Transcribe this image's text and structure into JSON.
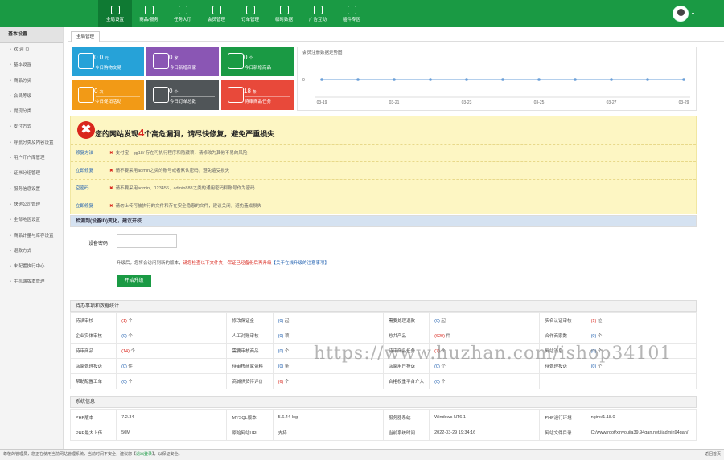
{
  "nav": [
    "全局设置",
    "商品/服务",
    "任务大厅",
    "会员管理",
    "订单管理",
    "临时数据",
    "广告互动",
    "插件专区"
  ],
  "sidebar": {
    "title": "基本设置",
    "items": [
      "欢 迎 页",
      "基本设置",
      "商品分类",
      "会员等级",
      "提现分类",
      "支付方式",
      "导航分类及内容设置",
      "用户开户库管理",
      "证书分组管理",
      "服务信息设置",
      "快递公司管理",
      "全部地区设置",
      "商品计量与库存设置",
      "退款方式",
      "未配置执行中心",
      "手机端版本管理"
    ]
  },
  "tab_label": "全局管理",
  "stats": [
    {
      "value": "0.0",
      "unit": "元",
      "label": "今日购物交易",
      "color": "#26a2d8"
    },
    {
      "value": "0",
      "unit": "家",
      "label": "今日新增商家",
      "color": "#8a56b4"
    },
    {
      "value": "0",
      "unit": "个",
      "label": "今日新增商品",
      "color": "#1a9a44"
    },
    {
      "value": "0",
      "unit": "次",
      "label": "今日促销活动",
      "color": "#f29a16"
    },
    {
      "value": "0",
      "unit": "个",
      "label": "今日订单总数",
      "color": "#505558"
    },
    {
      "value": "18",
      "unit": "条",
      "label": "待审商品任务",
      "color": "#e8493a"
    }
  ],
  "chart_data": {
    "type": "line",
    "title": "会员注册数据走势图",
    "categories": [
      "03-19",
      "03-20",
      "03-21",
      "03-22",
      "03-23",
      "03-24",
      "03-25",
      "03-26",
      "03-27",
      "03-28",
      "03-29"
    ],
    "x_tick_labels": [
      "03-19",
      "03-21",
      "03-23",
      "03-25",
      "03-27",
      "03-29"
    ],
    "series": [
      {
        "values": [
          0,
          0,
          0,
          0,
          0,
          0,
          0,
          0,
          0,
          0,
          0
        ]
      }
    ],
    "yticks": [
      "0"
    ],
    "ylim": [
      0,
      1
    ],
    "color": "#6a9fd8"
  },
  "alert": {
    "prefix": "您的网站发现",
    "count": "4",
    "suffix": "个高危漏洞，请尽快修复，避免严重损失",
    "rows": [
      {
        "key": "修复方法",
        "value": "支付宝：gg18/ 存在可执行程序和隐藏项，请修改为其他不易的风险"
      },
      {
        "key": "立即修复",
        "value": "请不要采用admin之类的账号或者默认密码，避免遭受损失"
      },
      {
        "key": "空密码",
        "value": "请不要采用admin、123456、admin888之类的通用密码和账号作为密码"
      },
      {
        "key": "立即修复",
        "value": "请勿上传可被执行的文件和存在安全隐患的文件，建议关闭，避免造成损失"
      }
    ]
  },
  "reset": {
    "header": "检测到(设备ID)变化，建议开校",
    "label": "设备密码：",
    "note_pre": "升级后，您将会访问到新的版本，",
    "note_red": "请您检查以下文件夹，保证已经备份后再升级",
    "note_link": "【关于在线升级的注意事项】",
    "button": "开始升级"
  },
  "pending": {
    "header": "待办事项和数据统计",
    "rows": [
      [
        [
          "待读审核",
          "(1)",
          "个"
        ],
        [
          "修改保证金",
          "(0)",
          "起"
        ],
        [
          "需要处理退款",
          "(0)",
          "起"
        ],
        [
          "实名认证审核",
          "(1)",
          "位"
        ]
      ],
      [
        [
          "企业实体审核",
          "(0)",
          "个"
        ],
        [
          "人工对账审核",
          "(0)",
          "项"
        ],
        [
          "总共产品",
          "(620)",
          "件"
        ],
        [
          "合作商家数",
          "(0)",
          "个"
        ]
      ],
      [
        [
          "待审商品",
          "(14)",
          "个"
        ],
        [
          "需要审核商品",
          "(0)",
          "个"
        ],
        [
          "待审商品任务",
          "(7)",
          "个"
        ],
        [
          "网站消息",
          "(0)",
          "个"
        ]
      ],
      [
        [
          "店家处理投诉",
          "(0)",
          "件"
        ],
        [
          "待审核商家资料",
          "(0)",
          "条"
        ],
        [
          "店家用户投诉",
          "(0)",
          "个"
        ],
        [
          "待处理投诉",
          "(0)",
          "个"
        ]
      ],
      [
        [
          "帮助配置工单",
          "(0)",
          "个"
        ],
        [
          "商城供货待评价",
          "(6)",
          "个"
        ],
        [
          "合格权重平台介入",
          "(0)",
          "个"
        ],
        [
          "",
          "",
          " "
        ]
      ]
    ]
  },
  "system": {
    "header": "系统信息",
    "rows": [
      [
        [
          "PHP版本",
          "7.2.34"
        ],
        [
          "MYSQL版本",
          "5.6.44-log"
        ],
        [
          "服务器系统",
          "Windows NT6.1"
        ],
        [
          "PHP运行环境",
          "nginx/1.18.0"
        ]
      ],
      [
        [
          "PHP最大上传",
          "50M"
        ],
        [
          "原始网站URL",
          "支持"
        ],
        [
          "当前系统时间",
          "2022-03-29 19:34:16"
        ],
        [
          "网站文件目录",
          "C:/www/root/xinyoujia39.94gan.net/jjadmin94gan/"
        ]
      ]
    ]
  },
  "footer": {
    "text_pre": "尊敬的管理员，您正在使用当前网站管理系统，当前时间不安全，建议您【",
    "link": "退出登录",
    "text_post": "】，以保证安全。",
    "right": "返回首页"
  },
  "watermark": "https://www.huzhan.com/ishop34101"
}
